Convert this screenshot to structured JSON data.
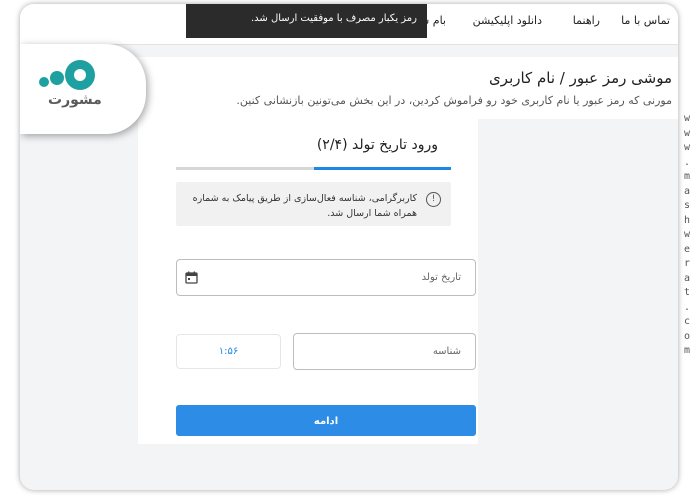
{
  "nav": {
    "items": [
      "تماس با ما",
      "راهنما",
      "دانلود اپلیکیشن",
      "بام شرکتی"
    ]
  },
  "toast": {
    "message": "رمز یکبار مصرف با موفقیت ارسال شد."
  },
  "header": {
    "title": "موشی رمز عبور / نام کاربری",
    "subtitle": "مورنی که رمز عبور یا نام کاربری خود رو فراموش کردین، در این بخش می‌تونین بازنشانی کنین."
  },
  "card": {
    "title": "ورود تاریخ تولد (۲/۴)",
    "step": 2,
    "total_steps": 4,
    "info": "کاربرگرامی، شناسه فعال‌سازی از طریق پیامک به شماره همراه شما ارسال شد.",
    "birthdate_placeholder": "تاریخ تولد",
    "id_placeholder": "شناسه",
    "timer": "۱:۵۶",
    "submit_label": "ادامه"
  },
  "logo": {
    "text": "مشورت"
  },
  "watermark": {
    "text": "www.mashwerat.com"
  },
  "colors": {
    "accent": "#2d8de6",
    "progress": "#1e88e5",
    "toast": "#2b2b2b"
  }
}
